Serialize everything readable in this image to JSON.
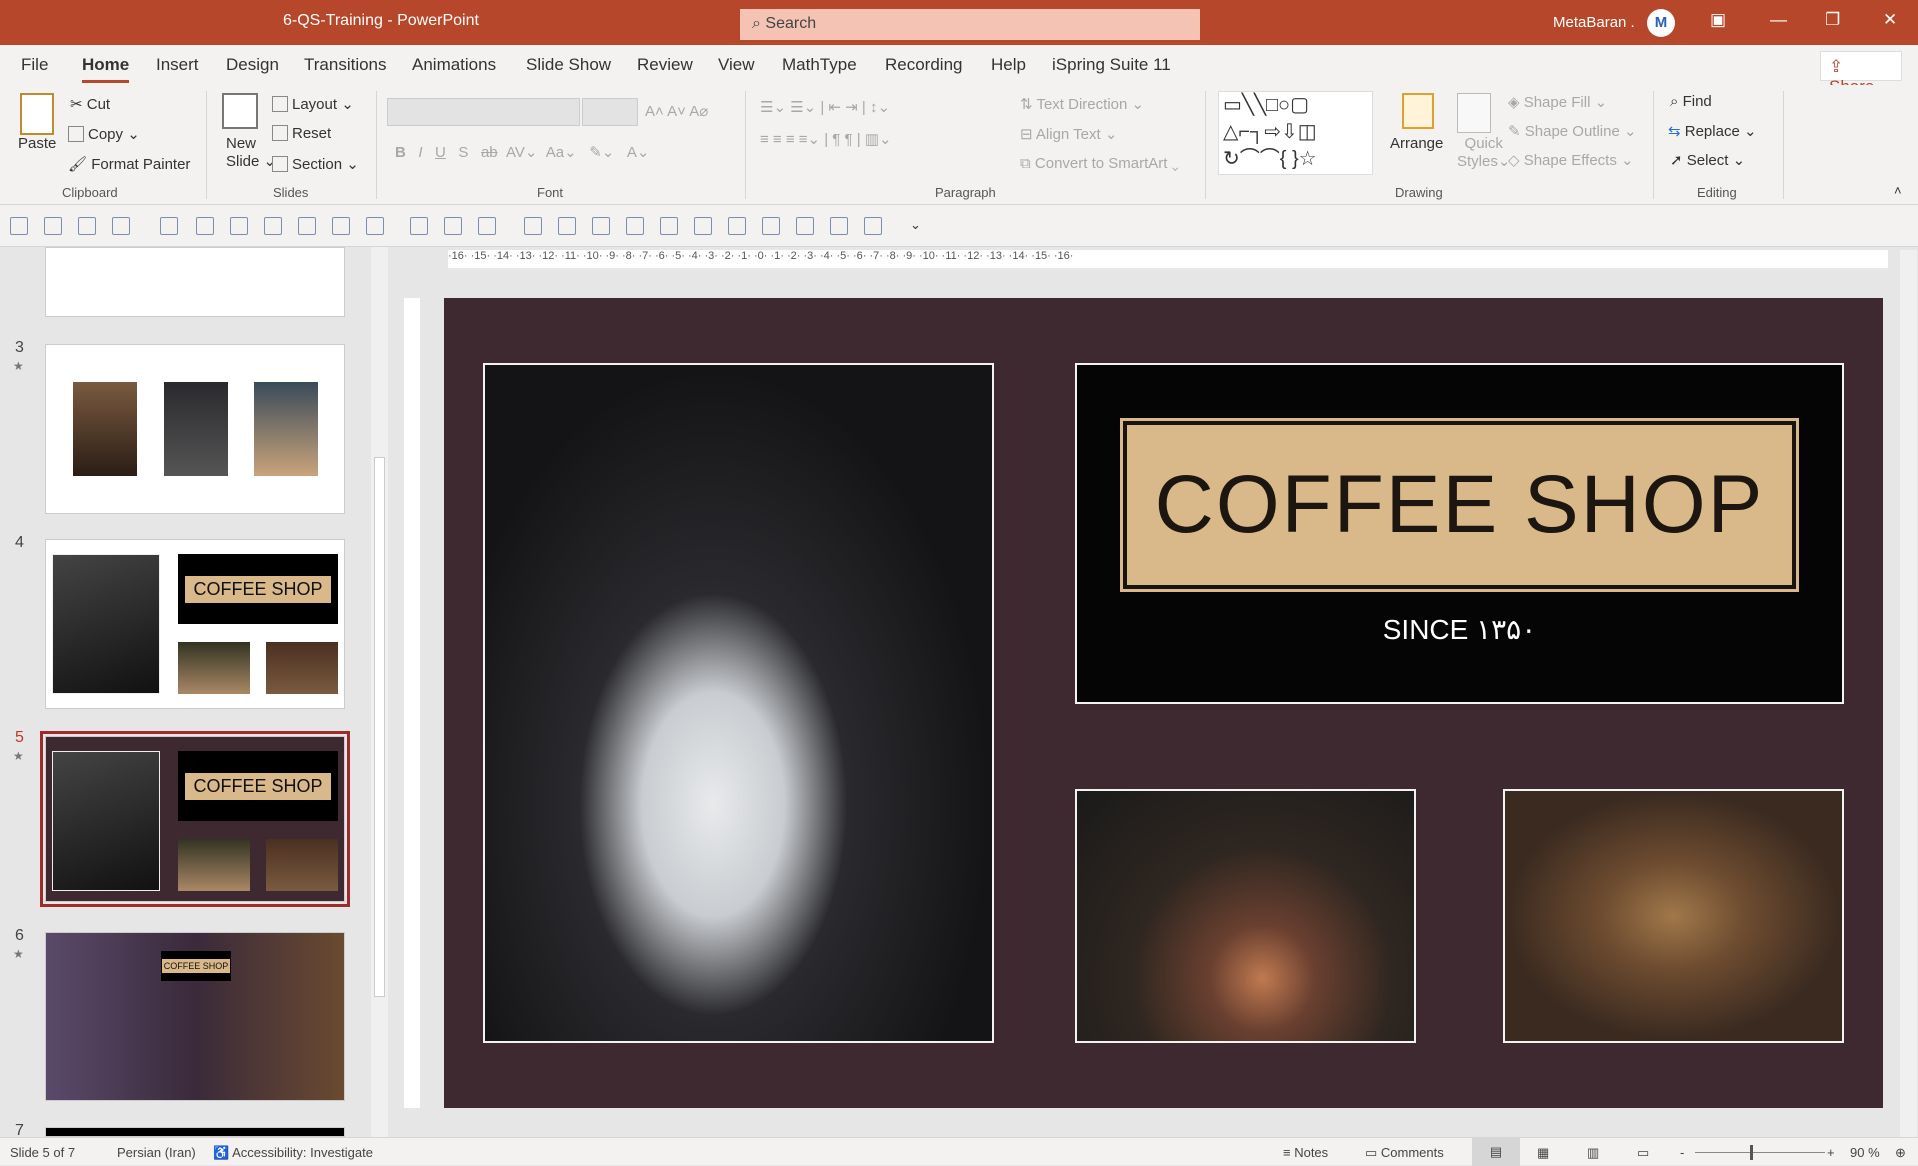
{
  "window": {
    "title": "6-QS-Training  -  PowerPoint",
    "search_placeholder": "Search",
    "user": "MetaBaran .",
    "accent": "#b7472a"
  },
  "tabs": [
    "File",
    "Home",
    "Insert",
    "Design",
    "Transitions",
    "Animations",
    "Slide Show",
    "Review",
    "View",
    "MathType",
    "Recording",
    "Help",
    "iSpring Suite 11"
  ],
  "share": "Share",
  "ribbon": {
    "clipboard": {
      "paste": "Paste",
      "cut": "Cut",
      "copy": "Copy",
      "format_painter": "Format Painter",
      "label": "Clipboard"
    },
    "slides": {
      "new_slide_1": "New",
      "new_slide_2": "Slide",
      "layout": "Layout",
      "reset": "Reset",
      "section": "Section",
      "label": "Slides"
    },
    "font": {
      "label": "Font",
      "bold": "B",
      "italic": "I",
      "underline": "U",
      "shadow": "S",
      "strike": "ab",
      "spacing": "AV",
      "case": "Aa"
    },
    "paragraph": {
      "label": "Paragraph",
      "text_direction": "Text Direction",
      "align_text": "Align Text",
      "convert": "Convert to SmartArt"
    },
    "drawing": {
      "label": "Drawing",
      "arrange": "Arrange",
      "quick_styles_1": "Quick",
      "quick_styles_2": "Styles",
      "shape_fill": "Shape Fill",
      "shape_outline": "Shape Outline",
      "shape_effects": "Shape Effects"
    },
    "editing": {
      "label": "Editing",
      "find": "Find",
      "replace": "Replace",
      "select": "Select"
    }
  },
  "thumbnails": [
    {
      "num": "3",
      "star": "★"
    },
    {
      "num": "4",
      "star": ""
    },
    {
      "num": "5",
      "star": "★",
      "selected": true
    },
    {
      "num": "6",
      "star": "★"
    },
    {
      "num": "7",
      "star": ""
    }
  ],
  "thumb_text": {
    "coffee_shop": "COFFEE SHOP"
  },
  "ruler": "·16· ·15· ·14· ·13· ·12· ·11· ·10· ·9· ·8· ·7· ·6· ·5· ·4· ·3· ·2· ·1· ·0· ·1· ·2· ·3· ·4· ·5· ·6· ·7· ·8· ·9· ·10· ·11· ·12· ·13· ·14· ·15· ·16·",
  "slide": {
    "sign_title": "COFFEE SHOP",
    "sign_since": "SINCE ۱۳۵۰",
    "background": "#3e2930",
    "plaque": "#d9b98a"
  },
  "status": {
    "slide": "Slide 5 of 7",
    "language": "Persian (Iran)",
    "accessibility": "Accessibility: Investigate",
    "notes": "Notes",
    "comments": "Comments",
    "zoom": "90 %",
    "zoom_minus": "-",
    "zoom_plus": "+"
  }
}
